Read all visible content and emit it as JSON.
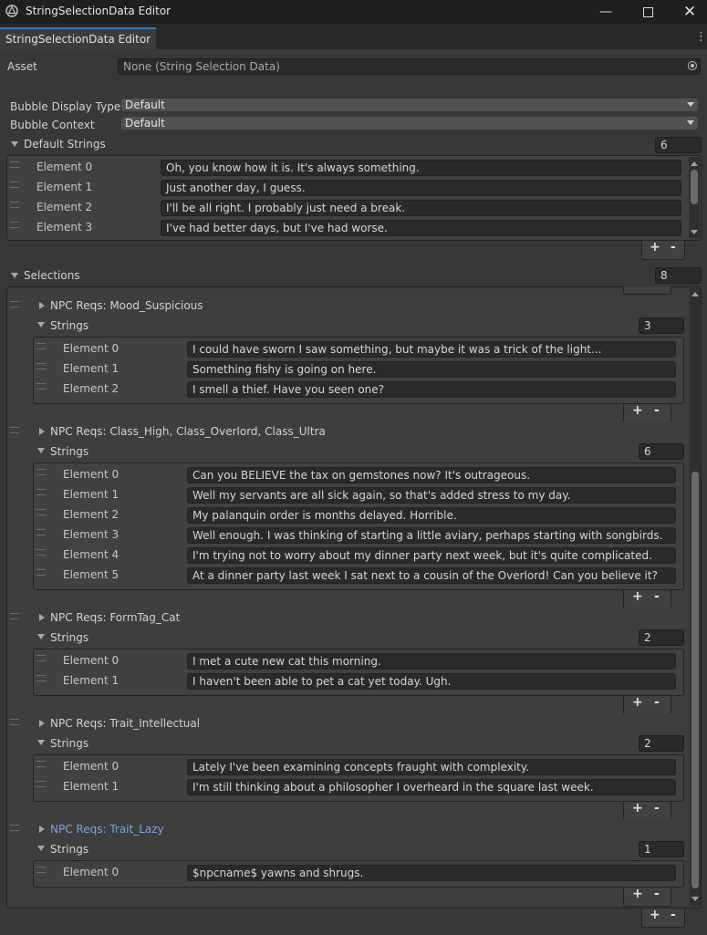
{
  "window": {
    "title": "StringSelectionData Editor",
    "tab": "StringSelectionData Editor"
  },
  "asset": {
    "label": "Asset",
    "value": "None (String Selection Data)"
  },
  "bubble_display_type": {
    "label": "Bubble Display Type",
    "value": "Default"
  },
  "bubble_context": {
    "label": "Bubble Context",
    "value": "Default"
  },
  "default_strings": {
    "label": "Default Strings",
    "count": "6",
    "elements": [
      {
        "label": "Element 0",
        "value": "Oh, you know how it is. It's always something."
      },
      {
        "label": "Element 1",
        "value": "Just another day, I guess."
      },
      {
        "label": "Element 2",
        "value": "I'll be all right. I probably just need a break."
      },
      {
        "label": "Element 3",
        "value": "I've had better days, but I've had worse."
      }
    ]
  },
  "selections": {
    "label": "Selections",
    "count": "8",
    "strings_label": "Strings",
    "items": [
      {
        "reqs": "NPC Reqs: Mood_Suspicious",
        "count": "3",
        "elements": [
          {
            "label": "Element 0",
            "value": "I could have sworn I saw something, but maybe it was a trick of the light..."
          },
          {
            "label": "Element 1",
            "value": "Something fishy is going on here."
          },
          {
            "label": "Element 2",
            "value": "I smell a thief. Have you seen one?"
          }
        ]
      },
      {
        "reqs": "NPC Reqs: Class_High, Class_Overlord, Class_Ultra",
        "count": "6",
        "elements": [
          {
            "label": "Element 0",
            "value": "Can you BELIEVE the tax on gemstones now? It's outrageous."
          },
          {
            "label": "Element 1",
            "value": "Well my servants are all sick again, so that's added stress to my day."
          },
          {
            "label": "Element 2",
            "value": "My palanquin order is months delayed. Horrible."
          },
          {
            "label": "Element 3",
            "value": "Well enough. I was thinking of starting a little aviary, perhaps starting with songbirds."
          },
          {
            "label": "Element 4",
            "value": "I'm trying not to worry about my dinner party next week, but it's quite complicated."
          },
          {
            "label": "Element 5",
            "value": "At a dinner party last week I sat next to a cousin of the Overlord! Can you believe it?"
          }
        ]
      },
      {
        "reqs": "NPC Reqs: FormTag_Cat",
        "count": "2",
        "elements": [
          {
            "label": "Element 0",
            "value": "I met a cute new cat this morning."
          },
          {
            "label": "Element 1",
            "value": "I haven't been able to pet a cat yet today. Ugh."
          }
        ]
      },
      {
        "reqs": "NPC Reqs: Trait_Intellectual",
        "count": "2",
        "elements": [
          {
            "label": "Element 0",
            "value": "Lately I've been examining concepts fraught with complexity."
          },
          {
            "label": "Element 1",
            "value": "I'm still thinking about a philosopher I overheard in the square last week."
          }
        ]
      },
      {
        "reqs": "NPC Reqs: Trait_Lazy",
        "count": "1",
        "elements": [
          {
            "label": "Element 0",
            "value": "$npcname$ yawns and shrugs."
          }
        ]
      }
    ]
  },
  "footer": {
    "add": "+",
    "remove": "-"
  },
  "colors": {
    "accent": "#3a79bb",
    "highlight_text": "#7aa6e0"
  }
}
